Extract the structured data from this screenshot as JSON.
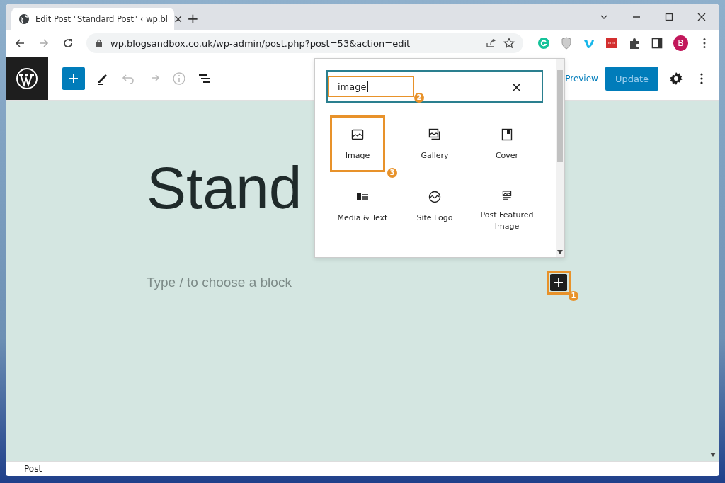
{
  "browser": {
    "tab_title": "Edit Post \"Standard Post\" ‹ wp.bl",
    "tab_close": "×",
    "new_tab": "+",
    "url": "wp.blogsandbox.co.uk/wp-admin/post.php?post=53&action=edit",
    "profile": "B"
  },
  "toolbar": {
    "preview": "Preview",
    "update": "Update"
  },
  "post": {
    "title": "Stand",
    "placeholder": "Type / to choose a block",
    "inserter_callout": "1"
  },
  "inserter": {
    "search": {
      "value": "image",
      "clear": "×",
      "callout": "2"
    },
    "blocks": [
      {
        "label": "Image",
        "kind": "image",
        "selected": true,
        "callout": "3"
      },
      {
        "label": "Gallery",
        "kind": "gallery",
        "selected": false
      },
      {
        "label": "Cover",
        "kind": "cover",
        "selected": false
      },
      {
        "label": "Media & Text",
        "kind": "media",
        "selected": false
      },
      {
        "label": "Site Logo",
        "kind": "logo",
        "selected": false
      },
      {
        "label": "Post Featured Image",
        "kind": "featured",
        "selected": false
      }
    ]
  },
  "status_bar": "Post"
}
